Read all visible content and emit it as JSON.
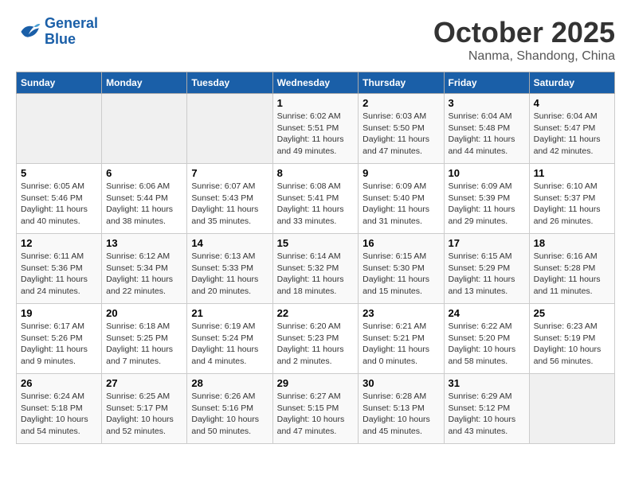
{
  "header": {
    "logo_line1": "General",
    "logo_line2": "Blue",
    "month": "October 2025",
    "location": "Nanma, Shandong, China"
  },
  "weekdays": [
    "Sunday",
    "Monday",
    "Tuesday",
    "Wednesday",
    "Thursday",
    "Friday",
    "Saturday"
  ],
  "weeks": [
    [
      {
        "day": "",
        "info": ""
      },
      {
        "day": "",
        "info": ""
      },
      {
        "day": "",
        "info": ""
      },
      {
        "day": "1",
        "info": "Sunrise: 6:02 AM\nSunset: 5:51 PM\nDaylight: 11 hours\nand 49 minutes."
      },
      {
        "day": "2",
        "info": "Sunrise: 6:03 AM\nSunset: 5:50 PM\nDaylight: 11 hours\nand 47 minutes."
      },
      {
        "day": "3",
        "info": "Sunrise: 6:04 AM\nSunset: 5:48 PM\nDaylight: 11 hours\nand 44 minutes."
      },
      {
        "day": "4",
        "info": "Sunrise: 6:04 AM\nSunset: 5:47 PM\nDaylight: 11 hours\nand 42 minutes."
      }
    ],
    [
      {
        "day": "5",
        "info": "Sunrise: 6:05 AM\nSunset: 5:46 PM\nDaylight: 11 hours\nand 40 minutes."
      },
      {
        "day": "6",
        "info": "Sunrise: 6:06 AM\nSunset: 5:44 PM\nDaylight: 11 hours\nand 38 minutes."
      },
      {
        "day": "7",
        "info": "Sunrise: 6:07 AM\nSunset: 5:43 PM\nDaylight: 11 hours\nand 35 minutes."
      },
      {
        "day": "8",
        "info": "Sunrise: 6:08 AM\nSunset: 5:41 PM\nDaylight: 11 hours\nand 33 minutes."
      },
      {
        "day": "9",
        "info": "Sunrise: 6:09 AM\nSunset: 5:40 PM\nDaylight: 11 hours\nand 31 minutes."
      },
      {
        "day": "10",
        "info": "Sunrise: 6:09 AM\nSunset: 5:39 PM\nDaylight: 11 hours\nand 29 minutes."
      },
      {
        "day": "11",
        "info": "Sunrise: 6:10 AM\nSunset: 5:37 PM\nDaylight: 11 hours\nand 26 minutes."
      }
    ],
    [
      {
        "day": "12",
        "info": "Sunrise: 6:11 AM\nSunset: 5:36 PM\nDaylight: 11 hours\nand 24 minutes."
      },
      {
        "day": "13",
        "info": "Sunrise: 6:12 AM\nSunset: 5:34 PM\nDaylight: 11 hours\nand 22 minutes."
      },
      {
        "day": "14",
        "info": "Sunrise: 6:13 AM\nSunset: 5:33 PM\nDaylight: 11 hours\nand 20 minutes."
      },
      {
        "day": "15",
        "info": "Sunrise: 6:14 AM\nSunset: 5:32 PM\nDaylight: 11 hours\nand 18 minutes."
      },
      {
        "day": "16",
        "info": "Sunrise: 6:15 AM\nSunset: 5:30 PM\nDaylight: 11 hours\nand 15 minutes."
      },
      {
        "day": "17",
        "info": "Sunrise: 6:15 AM\nSunset: 5:29 PM\nDaylight: 11 hours\nand 13 minutes."
      },
      {
        "day": "18",
        "info": "Sunrise: 6:16 AM\nSunset: 5:28 PM\nDaylight: 11 hours\nand 11 minutes."
      }
    ],
    [
      {
        "day": "19",
        "info": "Sunrise: 6:17 AM\nSunset: 5:26 PM\nDaylight: 11 hours\nand 9 minutes."
      },
      {
        "day": "20",
        "info": "Sunrise: 6:18 AM\nSunset: 5:25 PM\nDaylight: 11 hours\nand 7 minutes."
      },
      {
        "day": "21",
        "info": "Sunrise: 6:19 AM\nSunset: 5:24 PM\nDaylight: 11 hours\nand 4 minutes."
      },
      {
        "day": "22",
        "info": "Sunrise: 6:20 AM\nSunset: 5:23 PM\nDaylight: 11 hours\nand 2 minutes."
      },
      {
        "day": "23",
        "info": "Sunrise: 6:21 AM\nSunset: 5:21 PM\nDaylight: 11 hours\nand 0 minutes."
      },
      {
        "day": "24",
        "info": "Sunrise: 6:22 AM\nSunset: 5:20 PM\nDaylight: 10 hours\nand 58 minutes."
      },
      {
        "day": "25",
        "info": "Sunrise: 6:23 AM\nSunset: 5:19 PM\nDaylight: 10 hours\nand 56 minutes."
      }
    ],
    [
      {
        "day": "26",
        "info": "Sunrise: 6:24 AM\nSunset: 5:18 PM\nDaylight: 10 hours\nand 54 minutes."
      },
      {
        "day": "27",
        "info": "Sunrise: 6:25 AM\nSunset: 5:17 PM\nDaylight: 10 hours\nand 52 minutes."
      },
      {
        "day": "28",
        "info": "Sunrise: 6:26 AM\nSunset: 5:16 PM\nDaylight: 10 hours\nand 50 minutes."
      },
      {
        "day": "29",
        "info": "Sunrise: 6:27 AM\nSunset: 5:15 PM\nDaylight: 10 hours\nand 47 minutes."
      },
      {
        "day": "30",
        "info": "Sunrise: 6:28 AM\nSunset: 5:13 PM\nDaylight: 10 hours\nand 45 minutes."
      },
      {
        "day": "31",
        "info": "Sunrise: 6:29 AM\nSunset: 5:12 PM\nDaylight: 10 hours\nand 43 minutes."
      },
      {
        "day": "",
        "info": ""
      }
    ]
  ]
}
